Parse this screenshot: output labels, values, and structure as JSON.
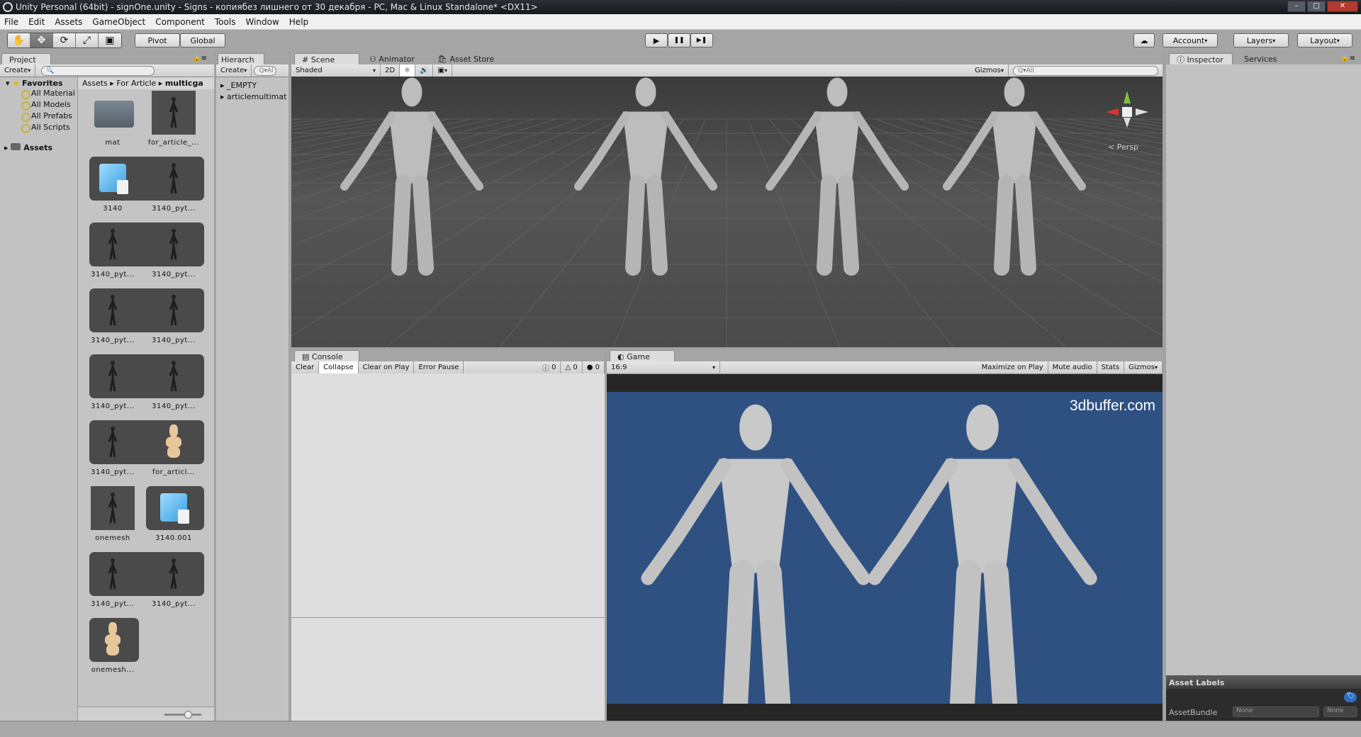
{
  "window": {
    "title": "Unity Personal (64bit) - signOne.unity - Signs - копиябез лишнего от 30 декабря - PC, Mac & Linux Standalone* <DX11>",
    "minimize": "–",
    "maximize": "□",
    "close": "✕"
  },
  "menu": [
    "File",
    "Edit",
    "Assets",
    "GameObject",
    "Component",
    "Tools",
    "Window",
    "Help"
  ],
  "toolbar": {
    "tools": [
      "✋",
      "✥",
      "⟳",
      "⤢",
      "▣"
    ],
    "pivot": "Pivot",
    "global": "Global",
    "play": "▶",
    "pause": "❚❚",
    "step": "▶❚",
    "account": "Account",
    "layers": "Layers",
    "layout": "Layout"
  },
  "project": {
    "tab": "Project",
    "create": "Create",
    "favorites": "Favorites",
    "fav_items": [
      "All Material",
      "All Models",
      "All Prefabs",
      "All Scripts"
    ],
    "assets": "Assets",
    "breadcrumb": [
      "Assets",
      "For Article",
      "multicga"
    ],
    "items": [
      [
        {
          "name": "mat",
          "type": "folder"
        },
        {
          "name": "for_article_...",
          "type": "model"
        }
      ],
      [
        {
          "name": "3140",
          "type": "prefab"
        },
        {
          "name": "3140_pyt...",
          "type": "mesh"
        }
      ],
      [
        {
          "name": "3140_pyt...",
          "type": "mesh"
        },
        {
          "name": "3140_pyt...",
          "type": "mesh"
        }
      ],
      [
        {
          "name": "3140_pyt...",
          "type": "mesh"
        },
        {
          "name": "3140_pyt...",
          "type": "mesh"
        }
      ],
      [
        {
          "name": "3140_pyt...",
          "type": "mesh"
        },
        {
          "name": "3140_pyt...",
          "type": "mesh"
        }
      ],
      [
        {
          "name": "3140_pyt...",
          "type": "mesh"
        },
        {
          "name": "for_articl...",
          "type": "avatar"
        }
      ],
      [
        {
          "name": "onemesh",
          "type": "model"
        },
        {
          "name": "3140.001",
          "type": "prefab"
        }
      ],
      [
        {
          "name": "3140_pyt...",
          "type": "mesh"
        },
        {
          "name": "3140_pyt...",
          "type": "mesh"
        }
      ],
      [
        {
          "name": "onemesh...",
          "type": "avatar"
        }
      ]
    ]
  },
  "hierarchy": {
    "tab": "Hierarch",
    "create": "Create",
    "search": "Q▾Al",
    "items": [
      "_EMPTY",
      "articlemultimat"
    ]
  },
  "scene": {
    "tabs": [
      "Scene",
      "Animator",
      "Asset Store"
    ],
    "shading": "Shaded",
    "mode2d": "2D",
    "gizmos": "Gizmos",
    "search": "Q▾All",
    "persp": "< Persp"
  },
  "console": {
    "tab": "Console",
    "buttons": [
      "Clear",
      "Collapse",
      "Clear on Play",
      "Error Pause"
    ],
    "info_count": "0",
    "warn_count": "0",
    "error_count": "0"
  },
  "game": {
    "tab": "Game",
    "aspect": "16:9",
    "buttons": [
      "Maximize on Play",
      "Mute audio",
      "Stats",
      "Gizmos"
    ],
    "watermark": "3dbuffer.com"
  },
  "inspector": {
    "tabs": [
      "Inspector",
      "Services"
    ],
    "asset_labels": "Asset Labels",
    "asset_bundle": "AssetBundle",
    "bundle_value": "None",
    "variant_value": "None"
  }
}
